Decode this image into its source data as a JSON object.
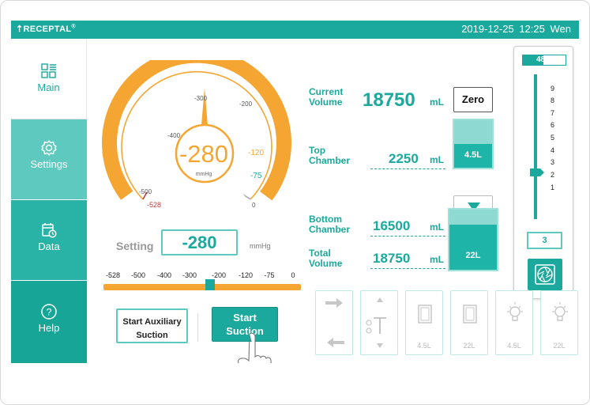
{
  "topbar": {
    "brand": "RECEPTAL",
    "brand_mark": "®",
    "date": "2019-12-25",
    "time": "12:25",
    "weekday": "Wen"
  },
  "sidebar": {
    "items": [
      {
        "label": "Main",
        "icon": "grid-list-icon"
      },
      {
        "label": "Settings",
        "icon": "gear-icon"
      },
      {
        "label": "Data",
        "icon": "calendar-clock-icon"
      },
      {
        "label": "Help",
        "icon": "question-icon"
      }
    ]
  },
  "gauge": {
    "value": "-280",
    "unit": "mmHg",
    "tick_labels": [
      "-528",
      "-500",
      "-400",
      "-300",
      "-200",
      "-120",
      "-75",
      "0"
    ],
    "range": [
      -528,
      0
    ],
    "colors": {
      "arc": "#f5a632",
      "needle": "#f5a632",
      "limit": "#c43c3c",
      "accent": "#1aa99c"
    }
  },
  "setting": {
    "label": "Setting",
    "value": "-280",
    "unit": "mmHg"
  },
  "scale": {
    "labels": [
      "-528",
      "-500",
      "-400",
      "-300",
      "-200",
      "-120",
      "-75",
      "0"
    ],
    "value": -240
  },
  "buttons": {
    "auxiliary_line1": "Start Auxiliary",
    "auxiliary_line2": "Suction",
    "start_line1": "Start",
    "start_line2": "Suction",
    "zero": "Zero"
  },
  "volumes": {
    "current_label_1": "Current",
    "current_label_2": "Volume",
    "current_value": "18750",
    "current_unit": "mL",
    "top_label_1": "Top",
    "top_label_2": "Chamber",
    "top_value": "2250",
    "top_unit": "mL",
    "bottom_label_1": "Bottom",
    "bottom_label_2": "Chamber",
    "bottom_value": "16500",
    "bottom_unit": "mL",
    "total_label_1": "Total",
    "total_label_2": "Volume",
    "total_value": "18750",
    "total_unit": "mL"
  },
  "tanks": {
    "top": {
      "label": "4.5L",
      "fill": 0.5
    },
    "bottom": {
      "label": "22L",
      "fill": 0.75
    }
  },
  "level": {
    "percent": "48%",
    "percent_value": 0.48,
    "scale": [
      "9",
      "8",
      "7",
      "6",
      "5",
      "4",
      "3",
      "2",
      "1"
    ],
    "value": "3"
  },
  "tools": [
    {
      "icon": "arrows-left-right-icon",
      "sub": ""
    },
    {
      "icon": "valve-icon",
      "sub": ""
    },
    {
      "icon": "door-icon",
      "sub": "4.5L"
    },
    {
      "icon": "door-icon",
      "sub": "22L"
    },
    {
      "icon": "bulb-icon",
      "sub": "4.5L"
    },
    {
      "icon": "bulb-icon",
      "sub": "22L"
    }
  ]
}
